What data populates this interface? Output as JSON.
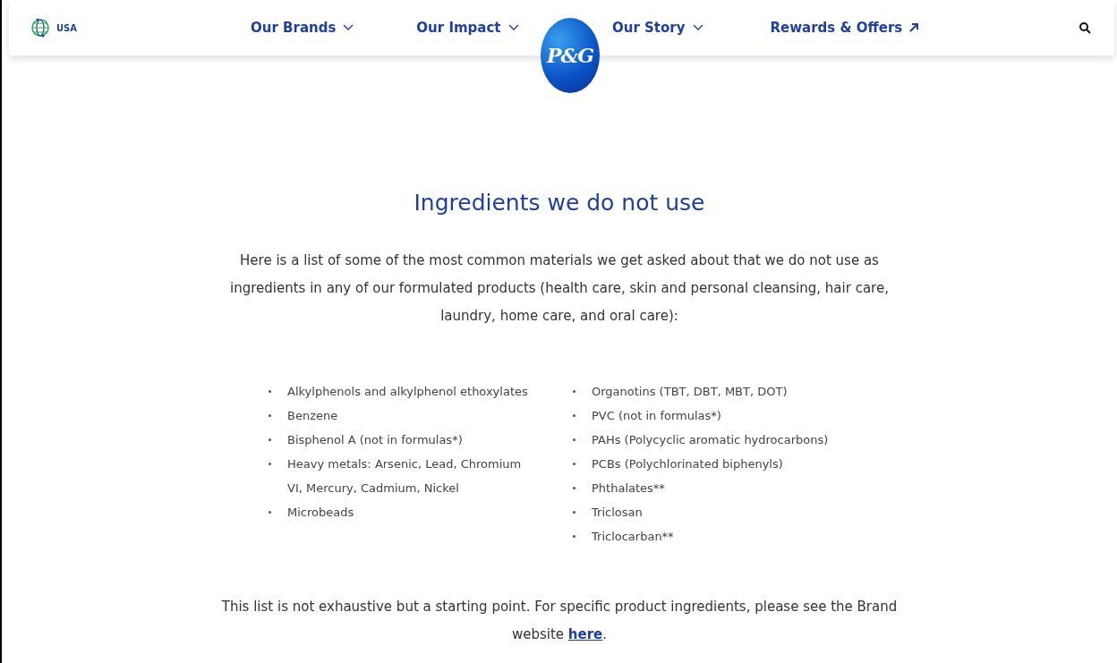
{
  "header": {
    "region": "USA",
    "nav_left": [
      {
        "label": "Our Brands",
        "kind": "dropdown"
      },
      {
        "label": "Our Impact",
        "kind": "dropdown"
      }
    ],
    "logo": "P&G",
    "nav_right": [
      {
        "label": "Our Story",
        "kind": "dropdown"
      },
      {
        "label": "Rewards & Offers",
        "kind": "external"
      }
    ]
  },
  "title": "Ingredients we do not use",
  "intro": "Here is a list of some of the most common materials we get asked about that we do not use as ingredients in any of our formulated products (health care, skin and personal cleansing, hair care, laundry, home care, and oral care):",
  "list_left": [
    "Alkylphenols and alkylphenol ethoxylates",
    "Benzene",
    "Bisphenol A (not in formulas*)",
    "Heavy metals: Arsenic, Lead, Chromium VI, Mercury, Cadmium, Nickel",
    "Microbeads"
  ],
  "list_right": [
    "Organotins (TBT, DBT, MBT, DOT)",
    "PVC (not in formulas*)",
    "PAHs (Polycyclic aromatic hydrocarbons)",
    "PCBs (Polychlorinated biphenyls)",
    "Phthalates**",
    "Triclosan",
    "Triclocarban**"
  ],
  "footer_note": {
    "text": "This list is not exhaustive but a starting point. For specific product ingredients, please see the Brand website ",
    "link": "here",
    "after": "."
  }
}
